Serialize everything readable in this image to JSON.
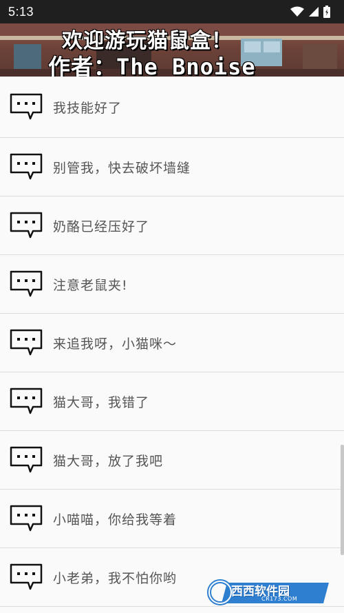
{
  "status_bar": {
    "time": "5:13",
    "icons": [
      "wifi-icon",
      "cellular-signal-icon",
      "battery-icon"
    ]
  },
  "banner": {
    "line1": "欢迎游玩猫鼠盒！",
    "line2": "作者：The_Bnoise"
  },
  "phrases": [
    {
      "text": "我技能好了",
      "icon": "chat-bubble-icon"
    },
    {
      "text": "别管我，快去破坏墙缝",
      "icon": "chat-bubble-icon"
    },
    {
      "text": "奶酪已经压好了",
      "icon": "chat-bubble-icon"
    },
    {
      "text": "注意老鼠夹!",
      "icon": "chat-bubble-icon"
    },
    {
      "text": "来追我呀，小猫咪～",
      "icon": "chat-bubble-icon"
    },
    {
      "text": "猫大哥，我错了",
      "icon": "chat-bubble-icon"
    },
    {
      "text": "猫大哥，放了我吧",
      "icon": "chat-bubble-icon"
    },
    {
      "text": "小喵喵，你给我等着",
      "icon": "chat-bubble-icon"
    },
    {
      "text": "小老弟，我不怕你哟",
      "icon": "chat-bubble-icon"
    }
  ],
  "watermark": {
    "text": "西西软件园",
    "sub": "CR173.COM"
  },
  "colors": {
    "status_bar": "#1f1f1f",
    "list_background": "#fafafa",
    "divider": "#dcdcdc",
    "phrase_text": "#555555",
    "icon_stroke": "#111111"
  }
}
